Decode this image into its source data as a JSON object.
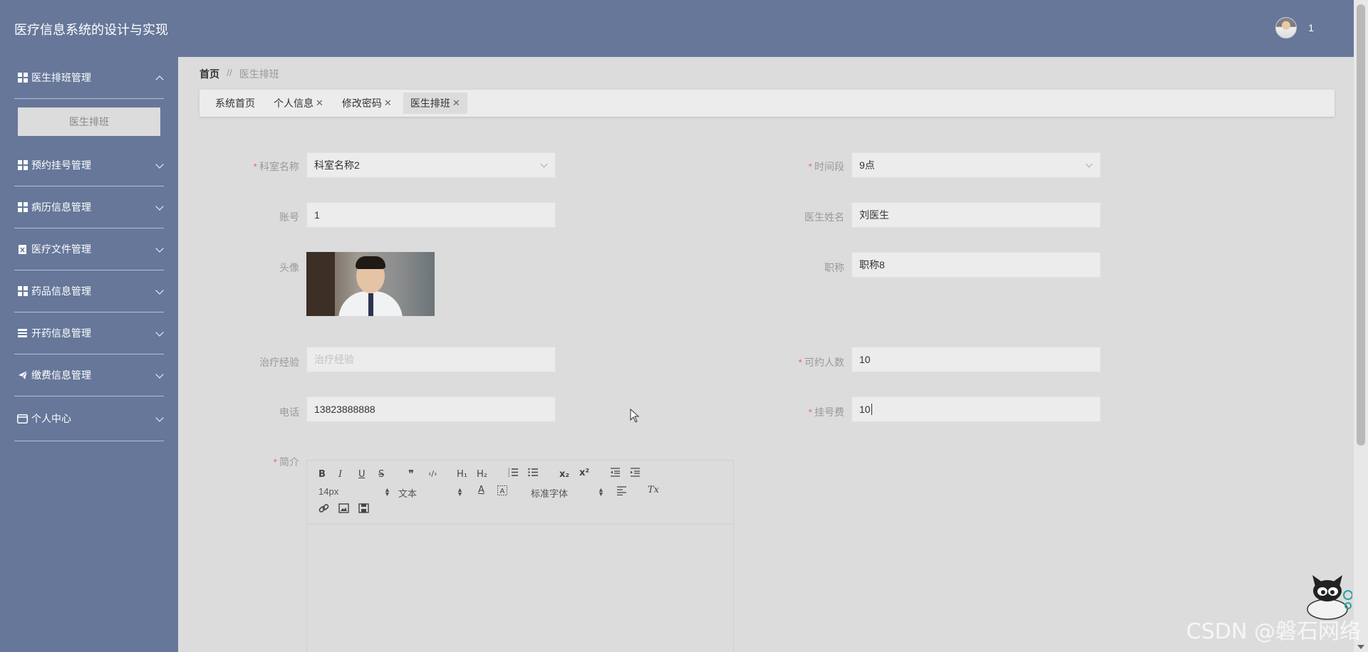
{
  "app": {
    "title": "医疗信息系统的设计与实现",
    "user_name": "1"
  },
  "sidebar": {
    "groups": [
      {
        "label": "医生排班管理",
        "icon": "grid-icon",
        "expanded": true,
        "children": [
          "医生排班"
        ]
      },
      {
        "label": "预约挂号管理",
        "icon": "grid-icon",
        "expanded": false
      },
      {
        "label": "病历信息管理",
        "icon": "grid-icon",
        "expanded": false
      },
      {
        "label": "医疗文件管理",
        "icon": "document-icon",
        "expanded": false
      },
      {
        "label": "药品信息管理",
        "icon": "grid-icon",
        "expanded": false
      },
      {
        "label": "开药信息管理",
        "icon": "list-icon",
        "expanded": false
      },
      {
        "label": "缴费信息管理",
        "icon": "send-icon",
        "expanded": false
      },
      {
        "label": "个人中心",
        "icon": "card-icon",
        "expanded": false
      }
    ]
  },
  "breadcrumb": {
    "home": "首页",
    "separator": "//",
    "current": "医生排班"
  },
  "tabs": [
    {
      "label": "系统首页",
      "closable": false,
      "active": false
    },
    {
      "label": "个人信息",
      "closable": true,
      "active": false
    },
    {
      "label": "修改密码",
      "closable": true,
      "active": false
    },
    {
      "label": "医生排班",
      "closable": true,
      "active": true
    }
  ],
  "form": {
    "department": {
      "label": "科室名称",
      "required": true,
      "value": "科室名称2"
    },
    "time_slot": {
      "label": "时间段",
      "required": true,
      "value": "9点"
    },
    "account": {
      "label": "账号",
      "required": false,
      "value": "1"
    },
    "doctor_name": {
      "label": "医生姓名",
      "required": false,
      "value": "刘医生"
    },
    "avatar": {
      "label": "头像",
      "required": false
    },
    "title": {
      "label": "职称",
      "required": false,
      "value": "职称8"
    },
    "experience": {
      "label": "治疗经验",
      "required": false,
      "value": "",
      "placeholder": "治疗经验"
    },
    "capacity": {
      "label": "可约人数",
      "required": true,
      "value": "10"
    },
    "phone": {
      "label": "电话",
      "required": false,
      "value": "13823888888"
    },
    "fee": {
      "label": "挂号费",
      "required": true,
      "value": "10"
    },
    "intro": {
      "label": "简介",
      "required": true
    }
  },
  "editor": {
    "buttons_row1": [
      "B",
      "I",
      "U",
      "S",
      "❞",
      "</>",
      "H1",
      "H2",
      "ol",
      "ul",
      "x₂",
      "x²",
      "outdent",
      "indent"
    ],
    "font_size": "14px",
    "paragraph": "文本",
    "font_family": "标准字体",
    "labels": {
      "bold": "B",
      "italic": "I",
      "underline": "U",
      "strike": "S",
      "quote": "❞",
      "code": "‹/›",
      "h1": "H₁",
      "h2": "H₂",
      "sub": "x₂",
      "sup": "x²",
      "color": "A",
      "clear": "Tx"
    }
  },
  "watermark": "CSDN @磐石网络",
  "colors": {
    "sidebar": "#667799",
    "content_bg": "#dcdcdc",
    "required": "#f56c6c"
  }
}
